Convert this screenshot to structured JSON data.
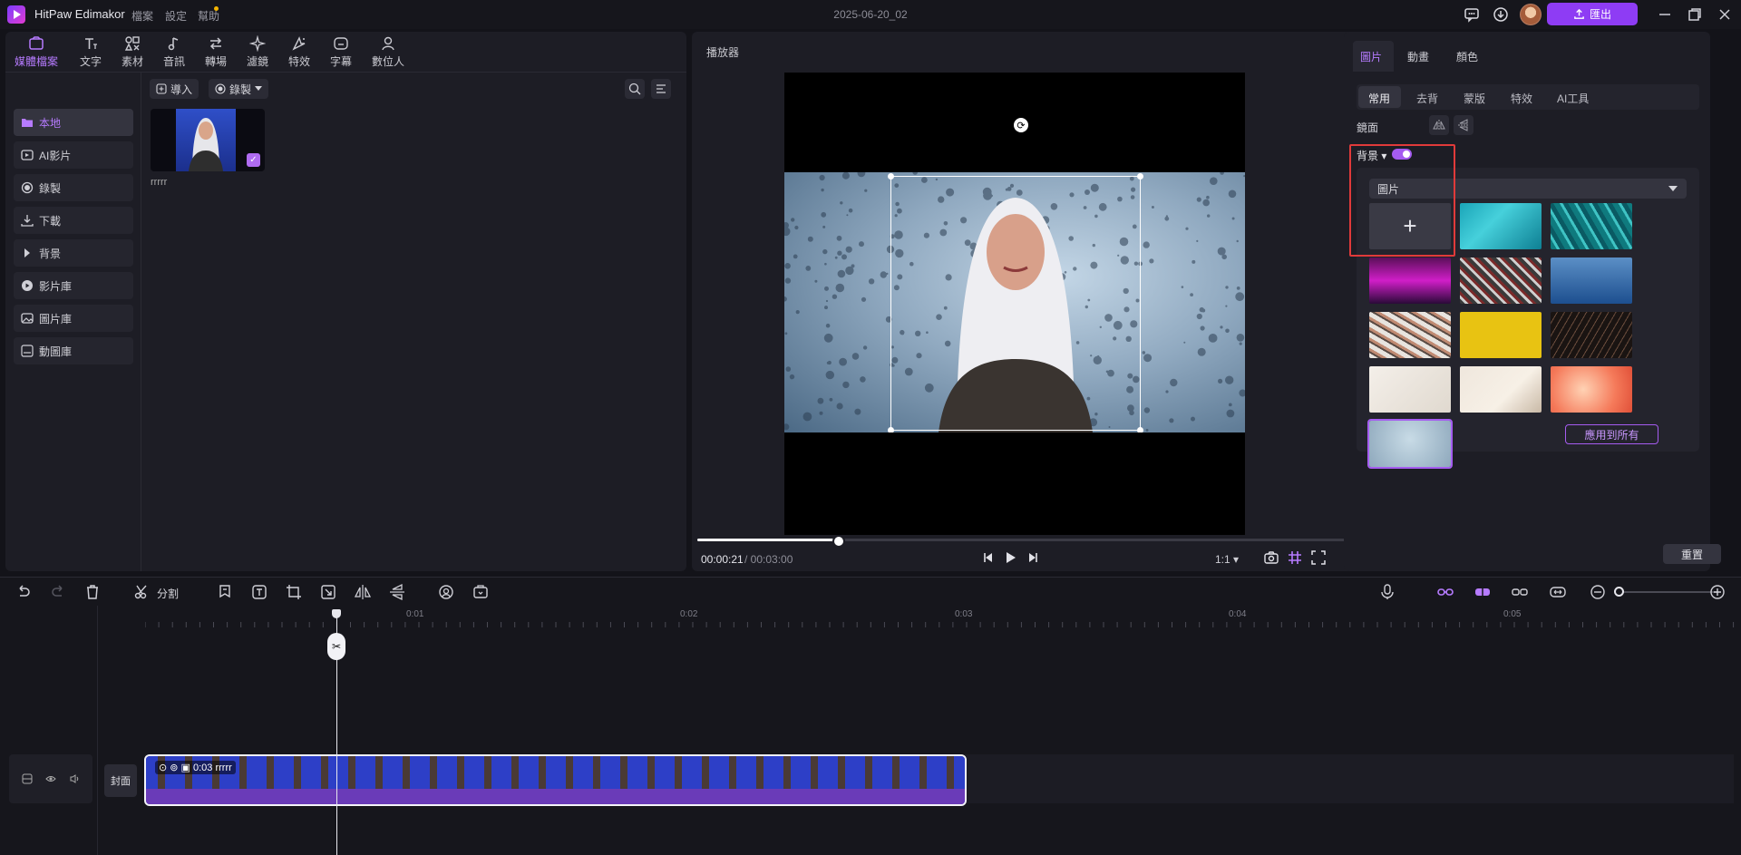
{
  "app": {
    "name": "HitPaw Edimakor",
    "menus": [
      "檔案",
      "設定",
      "幫助"
    ],
    "project_title": "2025-06-20_02",
    "export_label": "匯出"
  },
  "media_tabs": [
    {
      "label": "媒體檔案",
      "icon": "media-icon",
      "active": true
    },
    {
      "label": "文字",
      "icon": "text-icon"
    },
    {
      "label": "素材",
      "icon": "elements-icon"
    },
    {
      "label": "音訊",
      "icon": "audio-icon"
    },
    {
      "label": "轉場",
      "icon": "transition-icon"
    },
    {
      "label": "濾鏡",
      "icon": "filter-icon"
    },
    {
      "label": "特效",
      "icon": "effects-icon"
    },
    {
      "label": "字幕",
      "icon": "subtitle-icon"
    },
    {
      "label": "數位人",
      "icon": "avatar-icon"
    }
  ],
  "media_sidebar": [
    {
      "label": "本地",
      "icon": "folder-icon",
      "active": true
    },
    {
      "label": "AI影片",
      "icon": "ai-video-icon"
    },
    {
      "label": "錄製",
      "icon": "record-icon"
    },
    {
      "label": "下載",
      "icon": "download-icon"
    },
    {
      "label": "背景",
      "icon": "triangle-right-icon"
    },
    {
      "label": "影片庫",
      "icon": "video-library-icon"
    },
    {
      "label": "圖片庫",
      "icon": "image-library-icon"
    },
    {
      "label": "動圖庫",
      "icon": "gif-icon"
    }
  ],
  "media_toolbar": {
    "import_label": "導入",
    "record_label": "錄製"
  },
  "media_items": [
    {
      "name": "rrrrr"
    }
  ],
  "player": {
    "title": "播放器",
    "time_current": "00:00:21",
    "time_total": "/ 00:03:00",
    "progress": 0.21,
    "ratio": "1:1"
  },
  "properties": {
    "tabs": [
      "圖片",
      "動畫",
      "顏色"
    ],
    "sub_tabs": [
      "常用",
      "去背",
      "蒙版",
      "特效",
      "AI工具"
    ],
    "mirror_label": "鏡面",
    "background_label": "背景",
    "background_enabled": true,
    "background_type": "圖片",
    "apply_all_label": "應用到所有",
    "reset_label": "重置",
    "accent": "#a55cf0"
  },
  "timeline": {
    "split_label": "分割",
    "ticks": [
      "0:01",
      "0:02",
      "0:03",
      "0:04",
      "0:05"
    ],
    "cover_label": "封面",
    "clip_duration": "0:03",
    "clip_name": "rrrrr"
  }
}
